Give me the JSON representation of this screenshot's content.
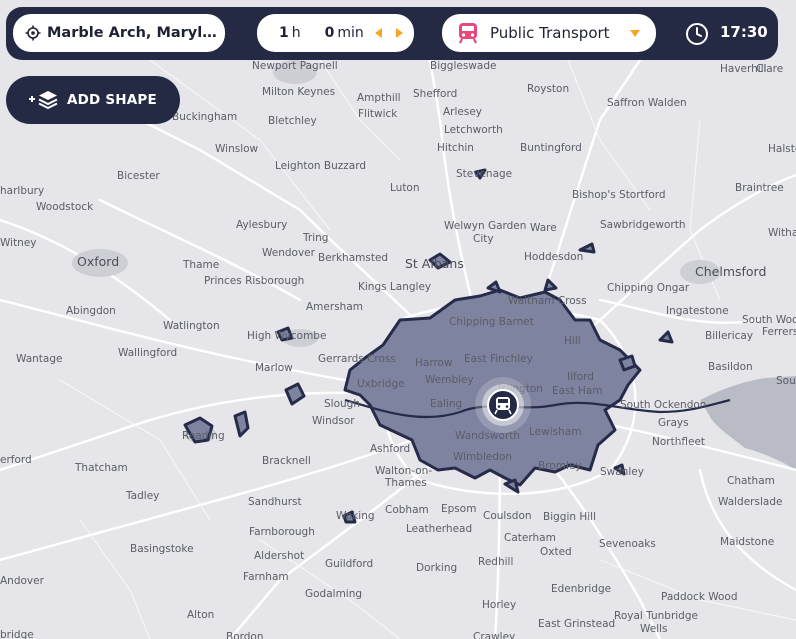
{
  "header": {
    "location": "Marble Arch, Marylebone, London",
    "travel_time": {
      "hours": "1",
      "hours_unit": "h",
      "minutes": "0",
      "minutes_unit": "min"
    },
    "mode_label": "Public Transport",
    "departure_time": "17:30"
  },
  "add_shape_label": "ADD SHAPE",
  "colors": {
    "isochrone_fill": "#7e84a0",
    "isochrone_outline": "#262b4a",
    "toolbar": "#252a44",
    "accent": "#f5a623",
    "transport_icon": "#e8497a"
  },
  "map": {
    "places": [
      {
        "name": "Newport Pagnell",
        "major": false
      },
      {
        "name": "Biggleswade",
        "major": false
      },
      {
        "name": "Haverhill",
        "major": false
      },
      {
        "name": "Clare",
        "major": false
      },
      {
        "name": "Milton Keynes",
        "major": false
      },
      {
        "name": "Ampthill",
        "major": false
      },
      {
        "name": "Shefford",
        "major": false
      },
      {
        "name": "Royston",
        "major": false
      },
      {
        "name": "Saffron Walden",
        "major": false
      },
      {
        "name": "Buckingham",
        "major": false
      },
      {
        "name": "Bletchley",
        "major": false
      },
      {
        "name": "Flitwick",
        "major": false
      },
      {
        "name": "Arlesey",
        "major": false
      },
      {
        "name": "Letchworth",
        "major": false
      },
      {
        "name": "Winslow",
        "major": false
      },
      {
        "name": "Hitchin",
        "major": false
      },
      {
        "name": "Buntingford",
        "major": false
      },
      {
        "name": "Halste",
        "major": false
      },
      {
        "name": "Leighton Buzzard",
        "major": false
      },
      {
        "name": "Stevenage",
        "major": false
      },
      {
        "name": "Bicester",
        "major": false
      },
      {
        "name": "Bishop's Stortford",
        "major": false
      },
      {
        "name": "Braintree",
        "major": false
      },
      {
        "name": "Luton",
        "major": false
      },
      {
        "name": "harlbury",
        "major": false
      },
      {
        "name": "Woodstock",
        "major": false
      },
      {
        "name": "Aylesbury",
        "major": false
      },
      {
        "name": "Welwyn Garden",
        "major": false
      },
      {
        "name": "City",
        "major": false
      },
      {
        "name": "Ware",
        "major": false
      },
      {
        "name": "Sawbridgeworth",
        "major": false
      },
      {
        "name": "Tring",
        "major": false
      },
      {
        "name": "Witha",
        "major": false
      },
      {
        "name": "Witney",
        "major": false
      },
      {
        "name": "Wendover",
        "major": false
      },
      {
        "name": "Hoddesdon",
        "major": false
      },
      {
        "name": "Oxford",
        "major": true
      },
      {
        "name": "Thame",
        "major": false
      },
      {
        "name": "Berkhamsted",
        "major": false
      },
      {
        "name": "St Albans",
        "major": true
      },
      {
        "name": "Chelmsford",
        "major": true
      },
      {
        "name": "Princes Risborough",
        "major": false
      },
      {
        "name": "Kings Langley",
        "major": false
      },
      {
        "name": "Waltham Cross",
        "major": false
      },
      {
        "name": "Chipping Ongar",
        "major": false
      },
      {
        "name": "Abingdon",
        "major": false
      },
      {
        "name": "Amersham",
        "major": false
      },
      {
        "name": "Ingatestone",
        "major": false
      },
      {
        "name": "Watlington",
        "major": false
      },
      {
        "name": "Chipping Barnet",
        "major": false
      },
      {
        "name": "South Wood",
        "major": false
      },
      {
        "name": "High Wycombe",
        "major": false
      },
      {
        "name": "Billericay",
        "major": false
      },
      {
        "name": "Ferrers",
        "major": false
      },
      {
        "name": "Wallingford",
        "major": false
      },
      {
        "name": "Wantage",
        "major": false
      },
      {
        "name": "Gerrards Cross",
        "major": false
      },
      {
        "name": "East Finchley",
        "major": false
      },
      {
        "name": "Hill",
        "major": false
      },
      {
        "name": "Harrow",
        "major": false
      },
      {
        "name": "Marlow",
        "major": false
      },
      {
        "name": "Basildon",
        "major": false
      },
      {
        "name": "Ilford",
        "major": false
      },
      {
        "name": "Wembley",
        "major": false
      },
      {
        "name": "Sou",
        "major": false
      },
      {
        "name": "Uxbridge",
        "major": false
      },
      {
        "name": "Islington",
        "major": false
      },
      {
        "name": "East Ham",
        "major": false
      },
      {
        "name": "Slough",
        "major": false
      },
      {
        "name": "Ealing",
        "major": false
      },
      {
        "name": "South Ockendon",
        "major": false
      },
      {
        "name": "Windsor",
        "major": false
      },
      {
        "name": "Grays",
        "major": false
      },
      {
        "name": "Reading",
        "major": false
      },
      {
        "name": "Wandsworth",
        "major": false
      },
      {
        "name": "Lewisham",
        "major": false
      },
      {
        "name": "Northfleet",
        "major": false
      },
      {
        "name": "Ashford",
        "major": false
      },
      {
        "name": "erford",
        "major": false
      },
      {
        "name": "Bracknell",
        "major": false
      },
      {
        "name": "Wimbledon",
        "major": false
      },
      {
        "name": "Thatcham",
        "major": false
      },
      {
        "name": "Bromley",
        "major": false
      },
      {
        "name": "Walton-on-",
        "major": false
      },
      {
        "name": "Thames",
        "major": false
      },
      {
        "name": "Swanley",
        "major": false
      },
      {
        "name": "Chatham",
        "major": false
      },
      {
        "name": "Tadley",
        "major": false
      },
      {
        "name": "Sandhurst",
        "major": false
      },
      {
        "name": "Cobham",
        "major": false
      },
      {
        "name": "Epsom",
        "major": false
      },
      {
        "name": "Walderslade",
        "major": false
      },
      {
        "name": "Leatherhead",
        "major": false
      },
      {
        "name": "Farnborough",
        "major": false
      },
      {
        "name": "Woking",
        "major": false
      },
      {
        "name": "Coulsdon",
        "major": false
      },
      {
        "name": "Biggin Hill",
        "major": false
      },
      {
        "name": "Caterham",
        "major": false
      },
      {
        "name": "Sevenoaks",
        "major": false
      },
      {
        "name": "Maidstone",
        "major": false
      },
      {
        "name": "Basingstoke",
        "major": false
      },
      {
        "name": "Oxted",
        "major": false
      },
      {
        "name": "Aldershot",
        "major": false
      },
      {
        "name": "Guildford",
        "major": false
      },
      {
        "name": "Dorking",
        "major": false
      },
      {
        "name": "Redhill",
        "major": false
      },
      {
        "name": "Farnham",
        "major": false
      },
      {
        "name": "Andover",
        "major": false
      },
      {
        "name": "Edenbridge",
        "major": false
      },
      {
        "name": "Godalming",
        "major": false
      },
      {
        "name": "Paddock Wood",
        "major": false
      },
      {
        "name": "Horley",
        "major": false
      },
      {
        "name": "Alton",
        "major": false
      },
      {
        "name": "Royal Tunbridge",
        "major": false
      },
      {
        "name": "East Grinstead",
        "major": false
      },
      {
        "name": "Wells",
        "major": false
      },
      {
        "name": "bridge",
        "major": false
      },
      {
        "name": "Bordon",
        "major": false
      },
      {
        "name": "Crawley",
        "major": false
      }
    ]
  }
}
